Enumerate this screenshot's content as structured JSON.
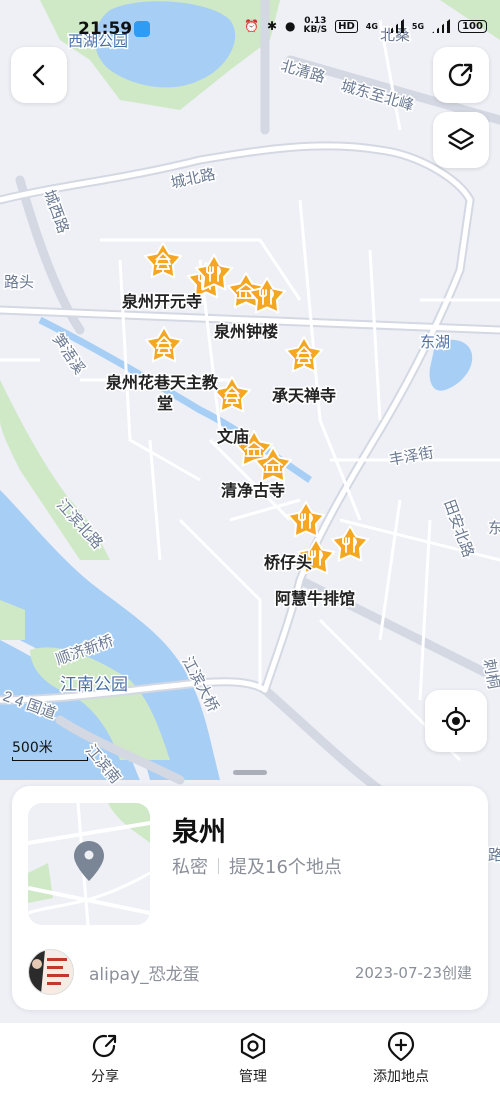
{
  "status_bar": {
    "time": "21:59",
    "net_speed_value": "0.13",
    "net_speed_unit": "KB/S",
    "hd": "HD",
    "net_4g": "4G",
    "net_5g": "5G",
    "battery": "100"
  },
  "map": {
    "area_labels": {
      "west_lake_park": "西湖公园",
      "east_lake": "东湖",
      "jiangnan_park": "江南公园"
    },
    "road_labels": {
      "beiqing_road": "北清路",
      "chengdong_beifeng": "城东至北峰",
      "chengbei_road": "城北路",
      "chengxi_road": "城西路",
      "matou": "路头",
      "brook": "笋浯溪",
      "fengze_street": "丰泽街",
      "tianan_north_road": "田安北路",
      "jiangbin_north_road": "江滨北路",
      "shunji_bridge": "顺济新桥",
      "jiangbin_bridge": "江滨大桥",
      "national_road": "2 4 国道",
      "jiangbin_south": "江滨南",
      "road_right_1": "刺桐",
      "road_right_2": "东",
      "road_right_3": "路",
      "road_top": "北桑"
    },
    "place_labels": {
      "kaiyuan_temple": "泉州开元寺",
      "bell_tower": "泉州钟楼",
      "catholic_church_line1": "泉州花巷天主教",
      "catholic_church_line2": "堂",
      "chengtian_temple": "承天禅寺",
      "confucius_temple": "文庙",
      "qingjing_mosque": "清净古寺",
      "qiaozai": "桥仔头",
      "ahui_steak": "阿慧牛排馆"
    },
    "markers": [
      {
        "name": "tower-marker",
        "kind": "tower"
      },
      {
        "name": "restaurant-marker",
        "kind": "fork"
      },
      {
        "name": "restaurant-marker",
        "kind": "fork"
      },
      {
        "name": "temple-marker",
        "kind": "temple"
      },
      {
        "name": "restaurant-marker",
        "kind": "fork"
      },
      {
        "name": "tower-marker",
        "kind": "tower"
      },
      {
        "name": "tower-marker",
        "kind": "tower"
      },
      {
        "name": "tower-marker",
        "kind": "tower"
      },
      {
        "name": "temple-marker",
        "kind": "temple"
      },
      {
        "name": "temple-marker",
        "kind": "temple"
      },
      {
        "name": "restaurant-marker",
        "kind": "fork"
      },
      {
        "name": "restaurant-marker",
        "kind": "fork"
      },
      {
        "name": "restaurant-marker",
        "kind": "fork"
      }
    ],
    "scale": "500米",
    "marker_color": "#f5a623"
  },
  "collection": {
    "title": "泉州",
    "privacy": "私密",
    "places": "提及16个地点",
    "author": "alipay_恐龙蛋",
    "created": "2023-07-23创建"
  },
  "bottom_bar": {
    "share": "分享",
    "manage": "管理",
    "add_place": "添加地点"
  }
}
